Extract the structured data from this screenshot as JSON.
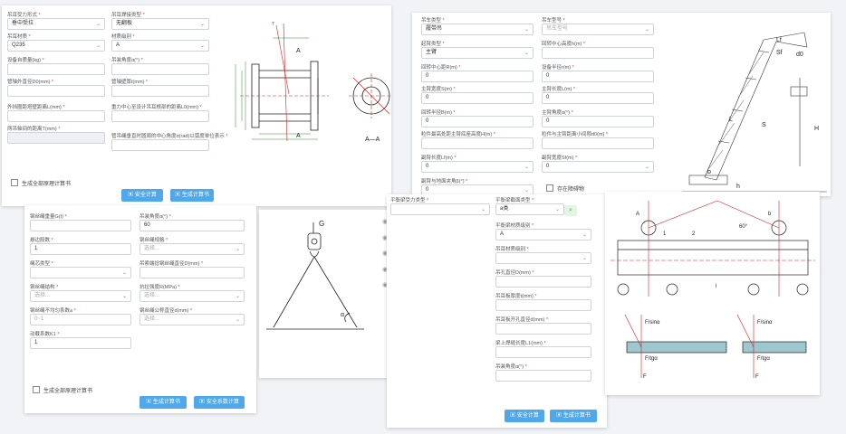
{
  "p1": {
    "fields": [
      {
        "label": "吊耳受力形式",
        "value": "垂中受拉",
        "ph": false,
        "sel": true
      },
      {
        "label": "吊耳焊接类型",
        "value": "无翻板",
        "ph": false,
        "sel": true
      },
      {
        "label": "吊耳材质",
        "value": "Q235",
        "ph": false,
        "sel": true
      },
      {
        "label": "材质级别",
        "value": "A",
        "ph": false,
        "sel": true
      },
      {
        "label": "设备自质量(kg)",
        "value": "",
        "ph": false,
        "sel": false
      },
      {
        "label": "吊装角度α(°)",
        "value": "",
        "ph": false,
        "sel": false
      },
      {
        "label": "管轴外直径D0(mm)",
        "value": "",
        "ph": false,
        "sel": false
      },
      {
        "label": "管轴壁厚t(mm)",
        "value": "",
        "ph": false,
        "sel": false
      },
      {
        "label": "外挡圈距塔壁距离L(mm)",
        "value": "",
        "ph": false,
        "sel": false
      },
      {
        "label": "重力中心至设计吊耳根部的距离L0(mm)",
        "value": "",
        "ph": false,
        "sel": false
      },
      {
        "label": "两吊轴间的距离T(mm)",
        "value": "",
        "ph": false,
        "sel": false,
        "dis": true
      },
      {
        "label": "管吊绳垂直时圆周的中心角度α(rad)以弧度单位表示",
        "value": "",
        "ph": false,
        "sel": false
      }
    ],
    "checkbox": "生成全部原理计算书",
    "btn1": "安全计算",
    "btn2": "生成计算书",
    "fig": {
      "a1": "A",
      "a2": "A",
      "sec": "A—A",
      "t": "T",
      "dims": [
        "φ250",
        "D0",
        "φ1",
        "φ2",
        "L",
        "L0"
      ]
    }
  },
  "p2": {
    "fields": [
      {
        "label": "吊车类型",
        "value": "履带吊",
        "ph": false,
        "sel": true
      },
      {
        "label": "吊车型号",
        "value": "吊车型号",
        "ph": true,
        "sel": true
      },
      {
        "label": "起臂类型",
        "value": "主臂",
        "ph": false,
        "sel": true
      },
      {
        "label": "回转中心高度h(m)",
        "value": "",
        "ph": false,
        "sel": false
      },
      {
        "label": "回转中心距R(m)",
        "value": "0",
        "ph": false,
        "sel": false
      },
      {
        "label": "设备半径r(m)",
        "value": "0",
        "ph": false,
        "sel": false
      },
      {
        "label": "主臂宽度S(m)",
        "value": "0",
        "ph": false,
        "sel": false
      },
      {
        "label": "主臂长度L(m)",
        "value": "0",
        "ph": false,
        "sel": false
      },
      {
        "label": "回转半径B(m)",
        "value": "0",
        "ph": false,
        "sel": false
      },
      {
        "label": "主臂角度α(°)",
        "value": "0",
        "ph": false,
        "sel": false
      },
      {
        "label": "粒件最高处距主臂底座高度H(m)",
        "value": "",
        "ph": false,
        "sel": false
      },
      {
        "label": "粒件与主臂距离小间隙d0(m)",
        "value": "",
        "ph": false,
        "sel": false
      },
      {
        "label": "副臂长度Lf(m)",
        "value": "0",
        "ph": false,
        "sel": true
      },
      {
        "label": "副臂宽度Sf(m)",
        "value": "0",
        "ph": false,
        "sel": true
      },
      {
        "label": "副臂与地面夹角β(°)",
        "value": "0",
        "ph": false,
        "sel": true
      }
    ],
    "checkbox": "存在障碍物",
    "fig": {
      "labels": [
        "Lf",
        "Sf",
        "d0",
        "β",
        "L",
        "S",
        "H",
        "R",
        "r",
        "b",
        "h",
        "α"
      ]
    }
  },
  "p3": {
    "fields": [
      {
        "label": "钢丝绳重量G(t)",
        "value": "",
        "ph": false,
        "sel": false
      },
      {
        "label": "吊装角度α(°)",
        "value": "60",
        "ph": false,
        "sel": false
      },
      {
        "label": "悬边股数",
        "value": "1",
        "ph": false,
        "sel": false
      },
      {
        "label": "钢丝绳规格",
        "value": "选择...",
        "ph": true,
        "sel": true
      },
      {
        "label": "绳芯类型",
        "value": "",
        "ph": false,
        "sel": true
      },
      {
        "label": "吊索端捻钢丝绳直径D(mm)",
        "value": "",
        "ph": false,
        "sel": false
      },
      {
        "label": "钢丝绳结构",
        "value": "选择...",
        "ph": true,
        "sel": true
      },
      {
        "label": "抗拉强度R(MPa)",
        "value": "选择...",
        "ph": true,
        "sel": true
      },
      {
        "label": "钢丝绳不均匀系数a",
        "value": "0~1",
        "ph": true,
        "sel": false
      },
      {
        "label": "钢丝绳公称直径d(mm)",
        "value": "选择...",
        "ph": true,
        "sel": true
      },
      {
        "label": "动载系数K1",
        "value": "1",
        "ph": false,
        "sel": false
      }
    ],
    "checkbox": "生成全部原理计算书",
    "btn1": "生成计算书",
    "btn2": "安全系数计算",
    "fig": {
      "g": "G",
      "a": "α"
    },
    "links": [
      "折减系数",
      "绳端连接强度能力",
      "报废标准",
      "安全系数要求",
      "钢丝绳不均匀系数说明"
    ]
  },
  "p4": {
    "fields": [
      {
        "label": "平衡梁受力类型",
        "value": "",
        "ph": false,
        "sel": true
      },
      {
        "label": "平衡梁截面类型",
        "value": "a类",
        "ph": false,
        "sel": true
      },
      {
        "label": "平衡梁材质级别",
        "value": "A",
        "ph": false,
        "sel": true
      },
      {
        "label": "吊耳材质级别",
        "value": "",
        "ph": false,
        "sel": true
      },
      {
        "label": "吊孔直径D(mm)",
        "value": "",
        "ph": false,
        "sel": false
      },
      {
        "label": "吊耳板厚度t(mm)",
        "value": "",
        "ph": false,
        "sel": false
      },
      {
        "label": "吊耳板开孔直径d(mm)",
        "value": "",
        "ph": false,
        "sel": false
      },
      {
        "label": "梁上焊缝长度L1(mm)",
        "value": "",
        "ph": false,
        "sel": false
      },
      {
        "label": "吊装角度α(°)",
        "value": "",
        "ph": false,
        "sel": false
      }
    ],
    "btn1": "安全计算",
    "btn2": "生成计算书",
    "fig": {
      "labels": [
        "A",
        "B",
        "1",
        "2",
        "60°",
        "b",
        "l",
        "F/sinα",
        "F/tgα",
        "F",
        "F/sinα",
        "F/tgα",
        "F"
      ]
    }
  },
  "colors": {
    "accent": "#4fa8ea",
    "required": "#e33",
    "link": "#3d7fd6"
  }
}
